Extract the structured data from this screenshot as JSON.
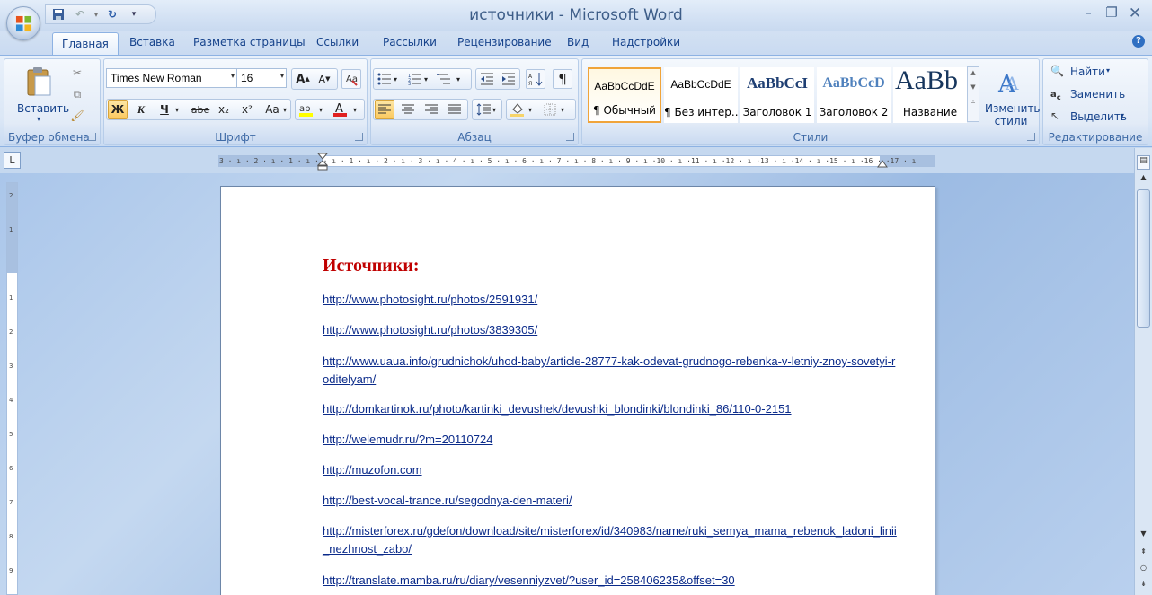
{
  "window": {
    "title": "источники - Microsoft Word"
  },
  "tabs": [
    {
      "label": "Главная"
    },
    {
      "label": "Вставка"
    },
    {
      "label": "Разметка страницы"
    },
    {
      "label": "Ссылки"
    },
    {
      "label": "Рассылки"
    },
    {
      "label": "Рецензирование"
    },
    {
      "label": "Вид"
    },
    {
      "label": "Надстройки"
    }
  ],
  "ribbon": {
    "clipboard": {
      "label": "Буфер обмена",
      "paste_label": "Вставить"
    },
    "font": {
      "label": "Шрифт",
      "font_name": "Times New Roman",
      "font_size": "16",
      "bold": "Ж",
      "italic": "К",
      "underline": "Ч",
      "strike": "abe",
      "subscript": "x₂",
      "superscript": "x²",
      "case": "Aa",
      "grow": "A",
      "shrink": "A"
    },
    "paragraph": {
      "label": "Абзац",
      "show_marks": "¶"
    },
    "styles": {
      "label": "Стили",
      "items": [
        {
          "sample": "AaBbCcDdE",
          "name": "¶ Обычный"
        },
        {
          "sample": "AaBbCcDdE",
          "name": "¶ Без интер..."
        },
        {
          "sample": "AaBbCcI",
          "name": "Заголовок 1"
        },
        {
          "sample": "AaBbCcD",
          "name": "Заголовок 2"
        },
        {
          "sample": "AaBb",
          "name": "Название"
        }
      ],
      "change_label": "Изменить стили"
    },
    "editing": {
      "label": "Редактирование",
      "find": "Найти",
      "replace": "Заменить",
      "select": "Выделить"
    }
  },
  "ruler": {
    "ticks": "3 · ı · 2 · ı · 1 · ı ·   · ı · 1 · ı · 2 · ı · 3 · ı · 4 · ı · 5 · ı · 6 · ı · 7 · ı · 8 · ı · 9 · ı ·10 · ı ·11 · ı ·12 · ı ·13 · ı ·14 · ı ·15 · ı ·16 ·   ·17 · ı"
  },
  "document": {
    "heading": "Источники:",
    "links": [
      "http://www.photosight.ru/photos/2591931/",
      "http://www.photosight.ru/photos/3839305/",
      "http://www.uaua.info/grudnichok/uhod-baby/article-28777-kak-odevat-grudnogo-rebenka-v-letniy-znoy-sovetyi-roditelyam/",
      "http://domkartinok.ru/photo/kartinki_devushek/devushki_blondinki/blondinki_86/110-0-2151",
      "http://welemudr.ru/?m=20110724",
      "http://muzofon.com",
      "http://best-vocal-trance.ru/segodnya-den-materi/",
      "http://misterforex.ru/gdefon/download/site/misterforex/id/340983/name/ruki_semya_mama_rebenok_ladoni_linii_nezhnost_zabo/",
      "http://translate.mamba.ru/ru/diary/vesenniyzvet/?user_id=258406235&offset=30"
    ]
  }
}
